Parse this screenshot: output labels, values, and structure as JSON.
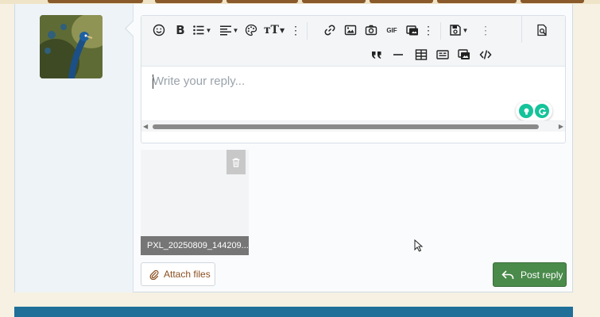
{
  "editor": {
    "placeholder": "Write your reply...",
    "toolbar": {
      "row1": [
        "smile-icon",
        "bold-icon",
        "list-icon",
        "align-icon",
        "palette-icon",
        "text-size-icon",
        "more-vertical-icon",
        "link-icon",
        "image-icon",
        "camera-icon",
        "gif-icon",
        "media-icon",
        "more-vertical-icon",
        "save-draft-icon",
        "more-vertical-icon",
        "preview-icon"
      ],
      "row2": [
        "quote-icon",
        "horizontal-rule-icon",
        "table-icon",
        "code-block-icon",
        "gallery-icon",
        "code-icon"
      ]
    },
    "gif_label": "GIF"
  },
  "attachment": {
    "filename": "PXL_20250809_144209..."
  },
  "buttons": {
    "attach_files": "Attach files",
    "post_reply": "Post reply"
  },
  "colors": {
    "post_button": "#4a8a4b",
    "attach_text": "#8a4e1f",
    "bottom_bar": "#1f6f99",
    "grammarly": "#15c39a"
  }
}
